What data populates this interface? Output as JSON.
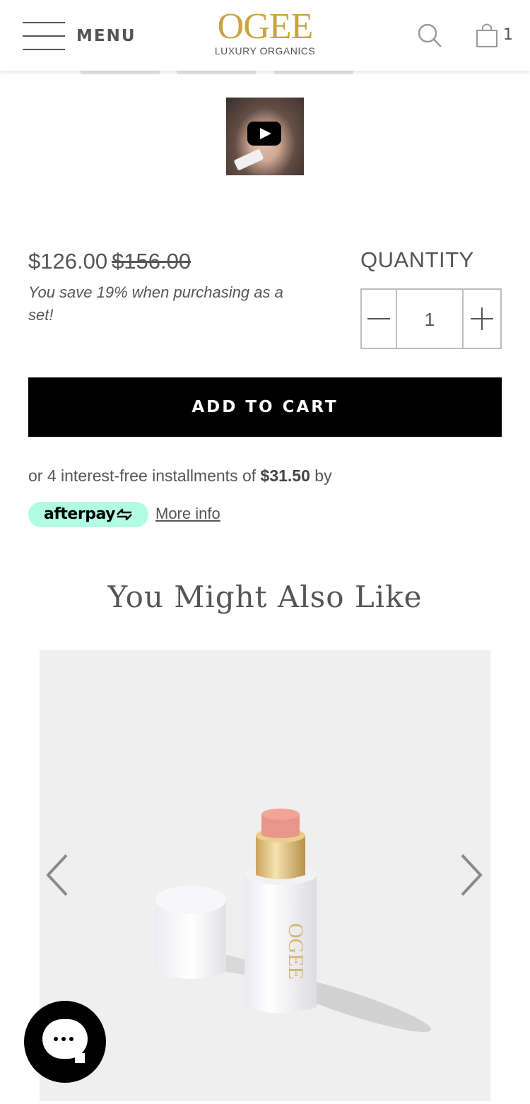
{
  "header": {
    "menu_label": "MENU",
    "logo_main": "OGEE",
    "logo_sub": "LUXURY ORGANICS",
    "cart_count": "1"
  },
  "product": {
    "price_current": "$126.00",
    "price_old": "$156.00",
    "save_note": "You save 19% when purchasing as a set!",
    "quantity_label": "QUANTITY",
    "quantity_value": "1",
    "add_to_cart": "ADD TO CART"
  },
  "afterpay": {
    "text_prefix": "or 4 interest-free installments of ",
    "amount": "$31.50",
    "text_suffix": " by",
    "badge": "afterpay",
    "more_info": "More info"
  },
  "recommendations": {
    "title": "You Might Also Like",
    "product_brand_text": "OGEE"
  },
  "colors": {
    "brand_gold": "#c9a43f",
    "text_gray": "#555555",
    "afterpay_mint": "#b2fce4",
    "button_black": "#000000"
  },
  "icons": [
    "hamburger-icon",
    "search-icon",
    "cart-bag-icon",
    "play-icon",
    "minus-icon",
    "plus-icon",
    "chevron-left-icon",
    "chevron-right-icon",
    "chat-icon"
  ]
}
